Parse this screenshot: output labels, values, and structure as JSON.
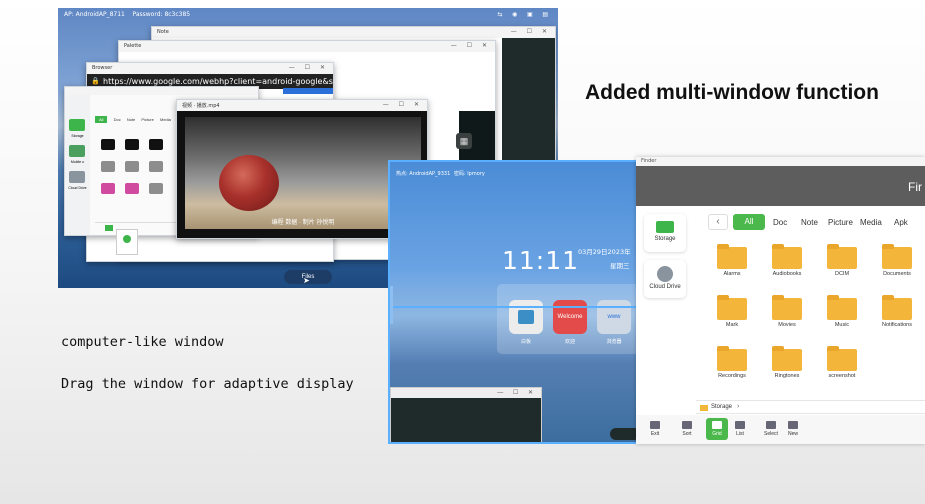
{
  "headline": "Added multi-window function",
  "captions": {
    "line1": "computer-like window",
    "line2": "Drag the window for adaptive display"
  },
  "shot1": {
    "status_ap": "AP: AndroidAP_8711",
    "status_password": "Password: 8c3c385",
    "windows": {
      "note_title": "Note",
      "palette_title": "Palette",
      "browser_title": "Browser",
      "browser_url": "https://www.google.com/webhp?client=android-google&source=ar",
      "video_title": "视频 · 播放.mp4",
      "video_subtitle": "编程  数据 · 制片  孙悦明"
    },
    "fm_sidebar": [
      "Storage",
      "Mobile u",
      "Cloud Drive"
    ],
    "fm_filters": [
      "All",
      "Doc",
      "Note",
      "Picture",
      "Media"
    ],
    "task_button": "Files"
  },
  "shot2": {
    "status_ap": "热点: AndroidAP_9331",
    "status_password": "密码: lpmory",
    "clock": "11:11",
    "date": "03月29日2023年",
    "weekday": "星期三",
    "apps": [
      {
        "label": "白板",
        "color": "#e8e8e8",
        "text": ""
      },
      {
        "label": "欢迎",
        "color": "#e34b4b",
        "text": "Welcome"
      },
      {
        "label": "浏览器",
        "color": "#cfd9e6",
        "text": "www"
      }
    ]
  },
  "finder": {
    "window_title": "Finder",
    "header_title": "Fir",
    "sidebar": [
      "Storage",
      "Cloud Drive"
    ],
    "filters": [
      "All",
      "Doc",
      "Note",
      "Picture",
      "Media",
      "Apk"
    ],
    "folders": [
      "Alarms",
      "Audiobooks",
      "DCIM",
      "Documents",
      "Mark",
      "Movies",
      "Music",
      "Notifications",
      "Recordings",
      "Ringtones",
      "screenshot"
    ],
    "path": "Storage",
    "bottom_buttons": [
      "Exit",
      "Sort",
      "Grid",
      "List",
      "Select",
      "New"
    ],
    "colors": {
      "accent": "#4ab84a",
      "folder": "#f3b63a",
      "header": "#5d5d5d"
    }
  }
}
